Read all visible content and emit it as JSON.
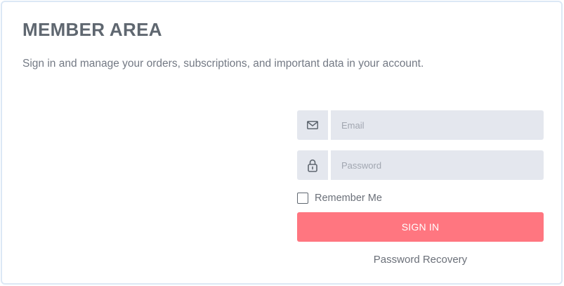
{
  "header": {
    "title": "MEMBER AREA",
    "subtitle": "Sign in and manage your orders, subscriptions, and important data in your account."
  },
  "form": {
    "email": {
      "icon": "envelope-icon",
      "placeholder": "Email",
      "value": ""
    },
    "password": {
      "icon": "lock-icon",
      "placeholder": "Password",
      "value": ""
    },
    "remember_label": "Remember Me",
    "remember_checked": false,
    "signin_label": "SIGN IN",
    "recovery_label": "Password Recovery"
  },
  "colors": {
    "accent": "#ff7680",
    "input_background": "#e4e7ee",
    "card_border": "#dce8f5",
    "title": "#5f6770"
  }
}
